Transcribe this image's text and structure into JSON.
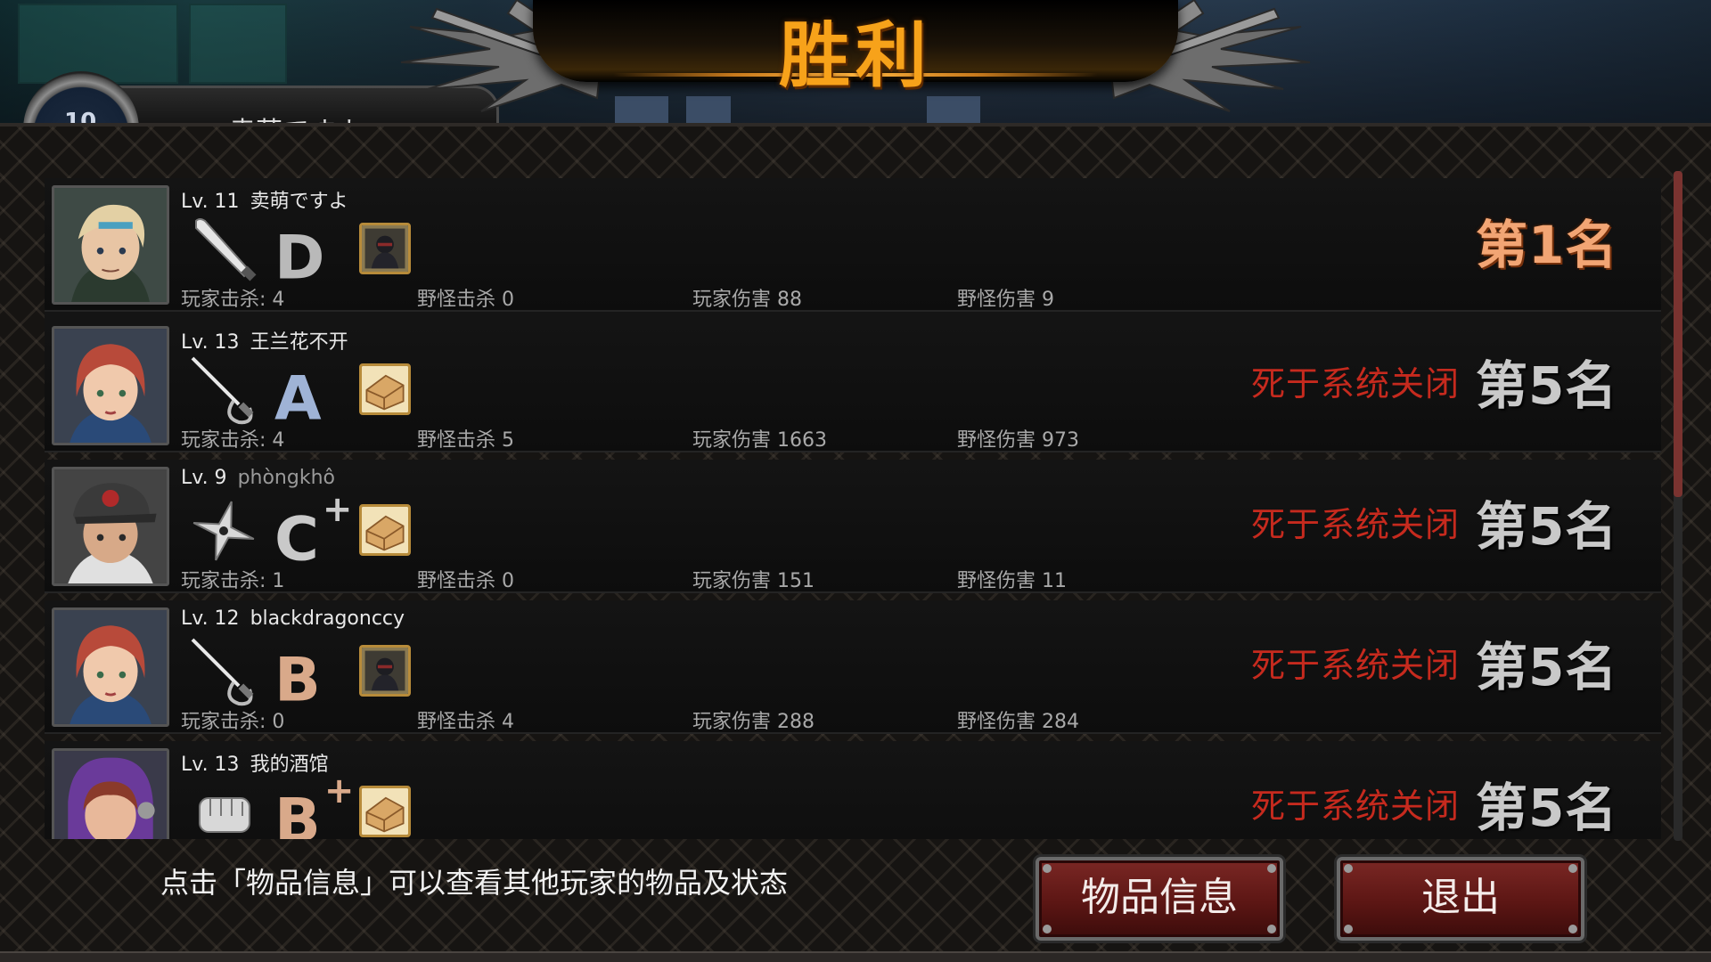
{
  "header": {
    "title": "胜利",
    "player_level_badge": "10",
    "player_name_partial": "卖萌ですよ"
  },
  "players": [
    {
      "level": "Lv. 11",
      "name": "卖萌ですよ",
      "weapon_icon": "baseball-bat-icon",
      "grade": "D",
      "grade_plus": "",
      "grade_color": "#b9b9b9",
      "item_icon": "ninja-item-icon",
      "player_kills": "玩家击杀: 4",
      "monster_kills": "野怪击杀 0",
      "player_damage": "玩家伤害 88",
      "monster_damage": "野怪伤害 9",
      "death_reason": "",
      "rank": "第1名",
      "is_first": true
    },
    {
      "level": "Lv. 13",
      "name": "王兰花不开",
      "weapon_icon": "rapier-icon",
      "grade": "A",
      "grade_plus": "",
      "grade_color": "#9fb3d6",
      "item_icon": "bread-item-icon",
      "player_kills": "玩家击杀: 4",
      "monster_kills": "野怪击杀 5",
      "player_damage": "玩家伤害 1663",
      "monster_damage": "野怪伤害 973",
      "death_reason": "死于系统关闭",
      "rank": "第5名",
      "is_first": false
    },
    {
      "level": "Lv. 9",
      "name": "phòngkhô",
      "weapon_icon": "shuriken-icon",
      "grade": "C",
      "grade_plus": "+",
      "grade_color": "#c9c9c9",
      "item_icon": "bread-item-icon",
      "player_kills": "玩家击杀: 1",
      "monster_kills": "野怪击杀 0",
      "player_damage": "玩家伤害 151",
      "monster_damage": "野怪伤害 11",
      "death_reason": "死于系统关闭",
      "rank": "第5名",
      "is_first": false
    },
    {
      "level": "Lv. 12",
      "name": "blackdragonccy",
      "weapon_icon": "rapier-icon",
      "grade": "B",
      "grade_plus": "",
      "grade_color": "#d9a98a",
      "item_icon": "ninja-item-icon",
      "player_kills": "玩家击杀: 0",
      "monster_kills": "野怪击杀 4",
      "player_damage": "玩家伤害 288",
      "monster_damage": "野怪伤害 284",
      "death_reason": "死于系统关闭",
      "rank": "第5名",
      "is_first": false
    },
    {
      "level": "Lv. 13",
      "name": "我的酒馆",
      "weapon_icon": "fist-icon",
      "grade": "B",
      "grade_plus": "+",
      "grade_color": "#d9a98a",
      "item_icon": "bread-item-icon",
      "player_kills": "",
      "monster_kills": "",
      "player_damage": "",
      "monster_damage": "",
      "death_reason": "死于系统关闭",
      "rank": "第5名",
      "is_first": false
    }
  ],
  "footer": {
    "hint": "点击「物品信息」可以查看其他玩家的物品及状态",
    "items_button": "物品信息",
    "exit_button": "退出"
  },
  "colors": {
    "title": "#f7a21a",
    "first_rank": "#f2a574",
    "death_reason": "#c62a1e",
    "button_red": "#5c1614"
  }
}
